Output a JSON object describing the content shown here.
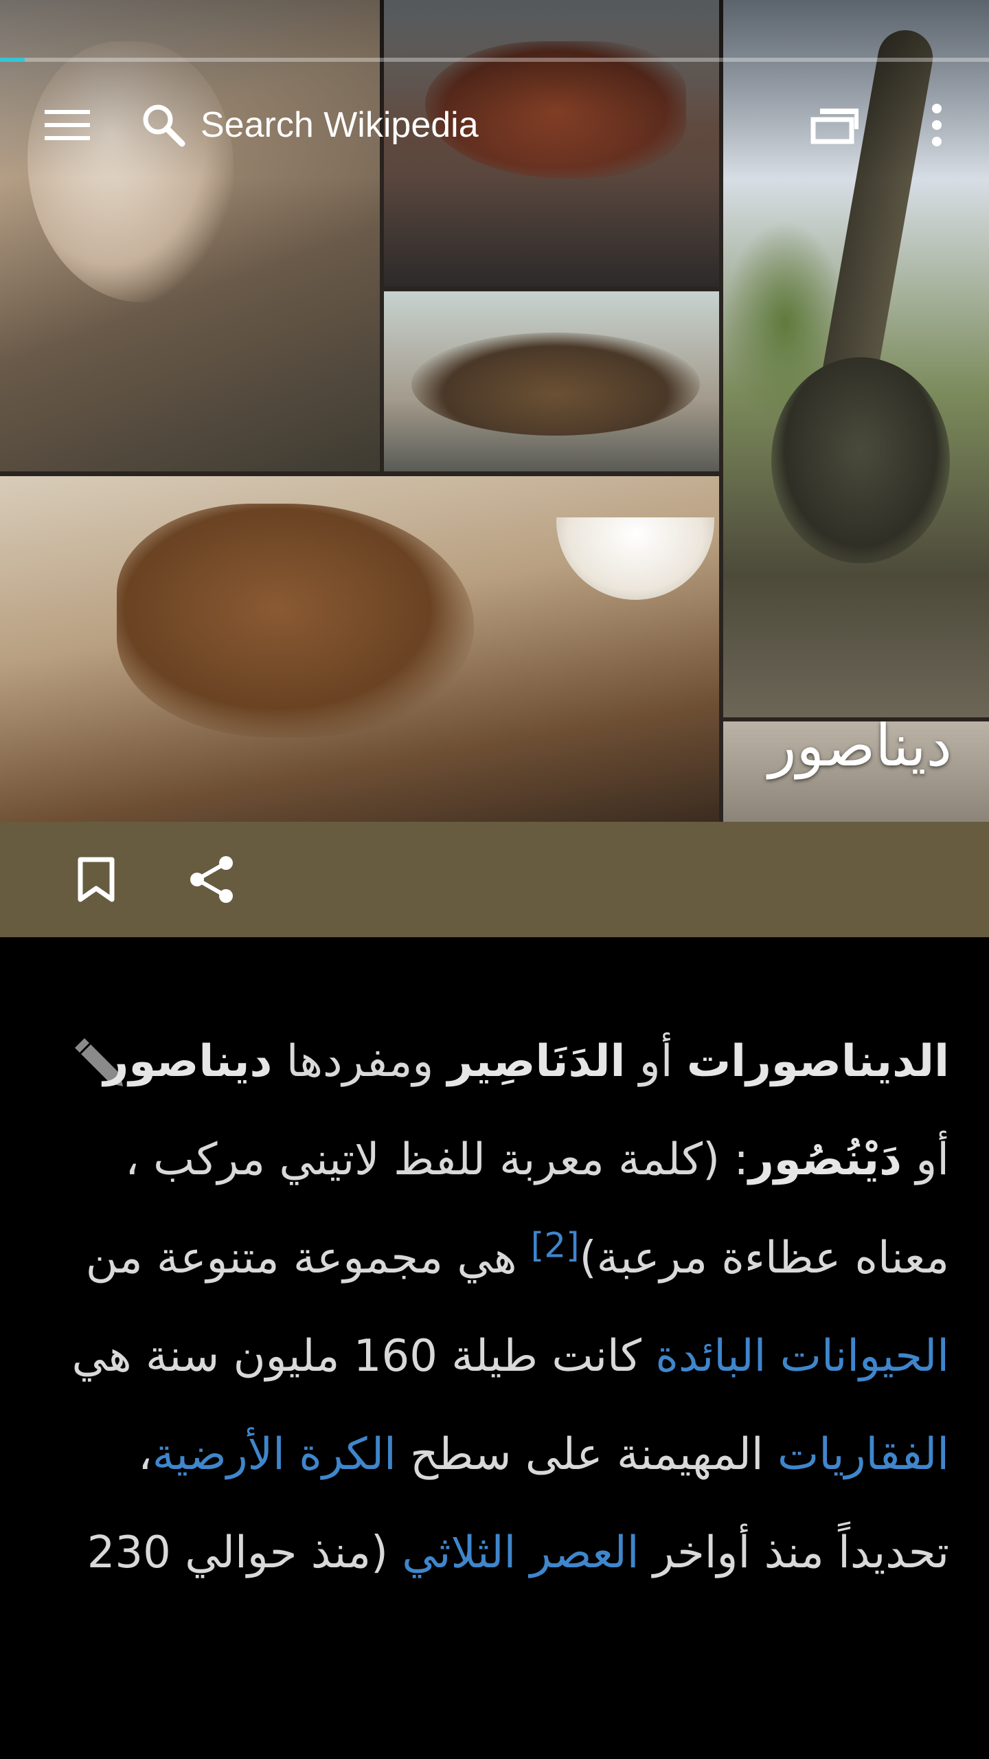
{
  "toolbar": {
    "search_placeholder": "Search Wikipedia"
  },
  "progress": {
    "fraction": 0.025
  },
  "icons": {
    "menu": "hamburger-icon",
    "search": "search-icon",
    "tabs": "tabs-icon",
    "overflow": "overflow-menu-icon",
    "bookmark": "bookmark-icon",
    "share": "share-icon",
    "edit": "pencil-icon"
  },
  "colors": {
    "action_bar": "#675c40",
    "link": "#3f86cc",
    "progress": "#36c5d6",
    "body_text": "#d9d9d9"
  },
  "article": {
    "title": "ديناصور",
    "lead": {
      "bold1": "الديناصورات",
      "t1": " أو ",
      "bold2": "الدَنَاصِير",
      "t2": " ومفردها ",
      "bold3": "ديناصور",
      "t3": " أو ",
      "bold4": "دَيْنُصُور",
      "t4": ": (كلمة معربة للفظ لاتيني مركب ، معناه عظاءة مرعبة)",
      "ref": "[2]",
      "t5": " هي مجموعة متنوعة من ",
      "link1": "الحيوانات البائدة",
      "t6": " كانت طيلة 160 مليون سنة هي ",
      "link2": "الفقاريات",
      "t7": " المهيمنة على سطح ",
      "link3": "الكرة الأرضية",
      "t8": "، تحديداً منذ أواخر ",
      "link4": "العصر الثلاثي",
      "t9": " (منذ حوالي 230"
    }
  }
}
